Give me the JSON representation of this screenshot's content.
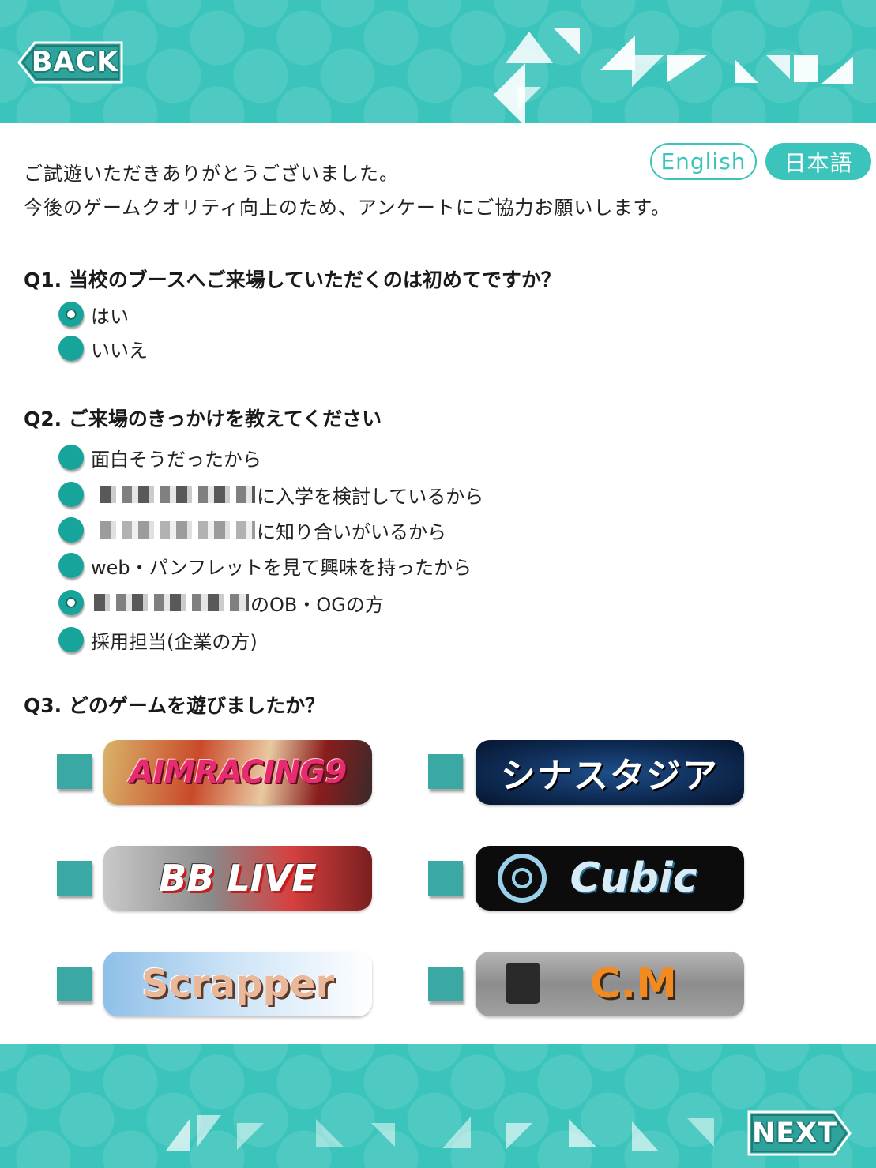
{
  "nav": {
    "back_label": "BACK",
    "next_label": "NEXT"
  },
  "language": {
    "english": "English",
    "japanese": "日本語",
    "selected": "日本語"
  },
  "intro": {
    "line1": "ご試遊いただきありがとうございました。",
    "line2": "今後のゲームクオリティ向上のため、アンケートにご協力お願いします。"
  },
  "q1": {
    "title": "Q1. 当校のブースへご来場していただくのは初めてですか？",
    "options": [
      {
        "label": "はい",
        "selected": true
      },
      {
        "label": "いいえ",
        "selected": false
      }
    ]
  },
  "q2": {
    "title": "Q2. ご来場のきっかけを教えてください",
    "options": [
      {
        "label": "面白そうだったから",
        "selected": false
      },
      {
        "label": "に入学を検討しているから",
        "selected": false
      },
      {
        "label": "に知り合いがいるから",
        "selected": false
      },
      {
        "label": "web・パンフレットを見て興味を持ったから",
        "selected": false
      },
      {
        "label": "のOB・OGの方",
        "selected": true
      },
      {
        "label": "採用担当(企業の方)",
        "selected": false
      }
    ]
  },
  "q3": {
    "title": "Q3. どのゲームを遊びましたか？",
    "games": [
      {
        "logo": "AIMRACING9",
        "checked": false
      },
      {
        "logo": "シナスタジア",
        "checked": false
      },
      {
        "logo": "BB LIVE",
        "checked": false
      },
      {
        "logo": "Cubic",
        "checked": false
      },
      {
        "logo": "Scrapper",
        "checked": false
      },
      {
        "logo": "C.M",
        "checked": false
      }
    ]
  },
  "colors": {
    "accent": "#3bc4bb",
    "radio": "#17a59b",
    "checkbox": "#3aa9a3"
  }
}
